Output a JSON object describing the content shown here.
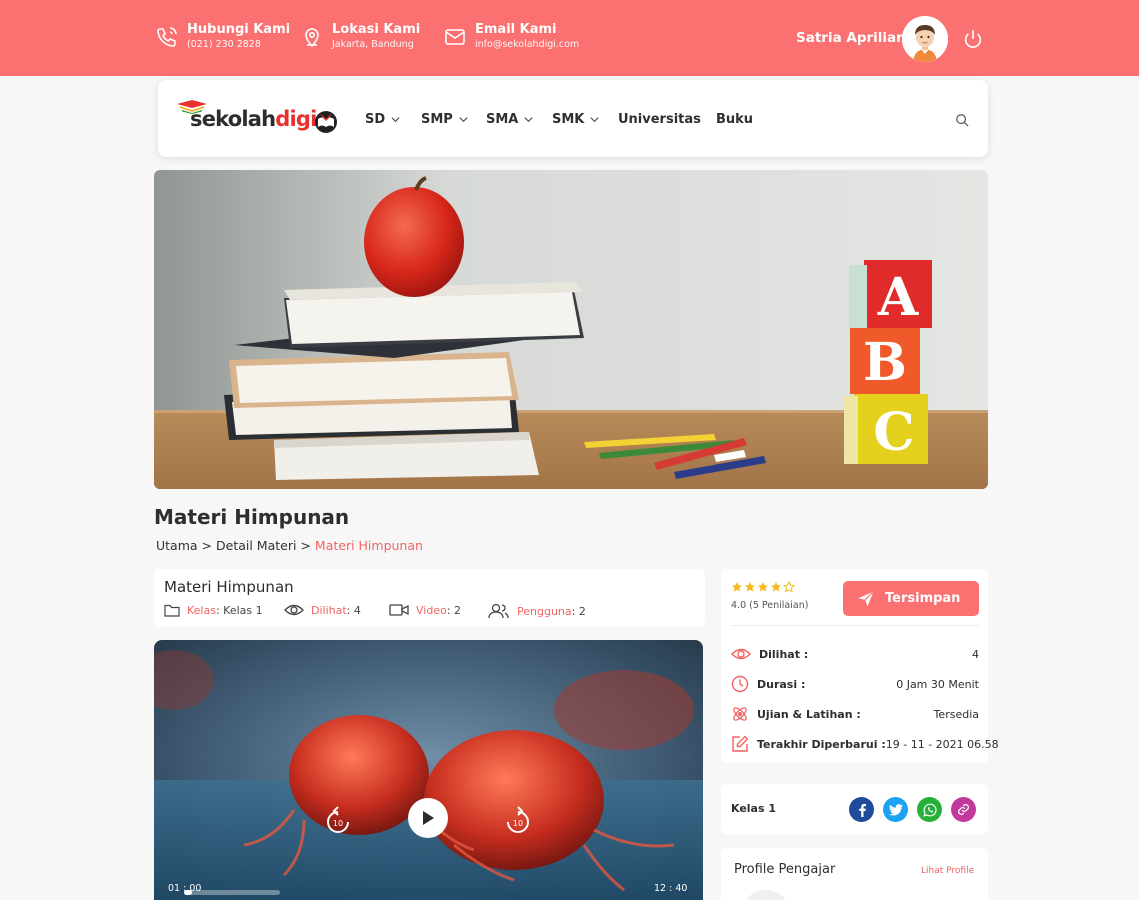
{
  "topbar": {
    "contacts": [
      {
        "icon": "phone-icon",
        "title": "Hubungi Kami",
        "detail": "(021) 230 2828"
      },
      {
        "icon": "location-pin-icon",
        "title": "Lokasi Kami",
        "detail": "Jakarta, Bandung"
      },
      {
        "icon": "mail-icon",
        "title": "Email Kami",
        "detail": "info@sekolahdigi.com"
      }
    ],
    "user_name": "Satria Aprilian"
  },
  "navbar": {
    "logo_a": "sekolah",
    "logo_b": "digi",
    "items": [
      {
        "label": "SD",
        "dropdown": true
      },
      {
        "label": "SMP",
        "dropdown": true
      },
      {
        "label": "SMA",
        "dropdown": true
      },
      {
        "label": "SMK",
        "dropdown": true
      },
      {
        "label": "Universitas",
        "dropdown": false
      },
      {
        "label": "Buku",
        "dropdown": false
      }
    ]
  },
  "page": {
    "title": "Materi Himpunan",
    "breadcrumb": {
      "home": "Utama",
      "sep": ">",
      "mid": "Detail Materi",
      "current": "Materi Himpunan"
    }
  },
  "info": {
    "title": "Materi Himpunan",
    "kelas_label": "Kelas",
    "kelas_value": ": Kelas 1",
    "dilihat_label": "Dilihat",
    "dilihat_value": ": 4",
    "video_label": "Video",
    "video_value": ": 2",
    "pengguna_label": "Pengguna",
    "pengguna_value": ": 2"
  },
  "video": {
    "current_time": "01 : 00",
    "duration": "12 : 40",
    "progress_fraction": 0.08,
    "skip_seconds": "10"
  },
  "rating": {
    "stars": 4,
    "max_stars": 5,
    "text": "4.0 (5 Penilaian)",
    "save_label": "Tersimpan"
  },
  "stats": [
    {
      "icon": "eye-icon",
      "label": "Dilihat :",
      "value": "4"
    },
    {
      "icon": "clock-icon",
      "label": "Durasi :",
      "value": "0 Jam 30 Menit"
    },
    {
      "icon": "atom-icon",
      "label": "Ujian & Latihan :",
      "value": "Tersedia"
    },
    {
      "icon": "edit-icon",
      "label": "Terakhir Diperbarui :",
      "value": "19 - 11 - 2021 06.58"
    }
  ],
  "share": {
    "label": "Kelas 1",
    "buttons": [
      {
        "name": "facebook-icon",
        "color": "#1f4b99"
      },
      {
        "name": "twitter-icon",
        "color": "#1da1f2"
      },
      {
        "name": "whatsapp-icon",
        "color": "#25b03a"
      },
      {
        "name": "link-icon",
        "color": "#c2389c"
      }
    ]
  },
  "profile": {
    "title": "Profile Pengajar",
    "link": "Lihat Profile"
  },
  "colors": {
    "accent": "#fb7070",
    "accent_text": "#f26464"
  }
}
